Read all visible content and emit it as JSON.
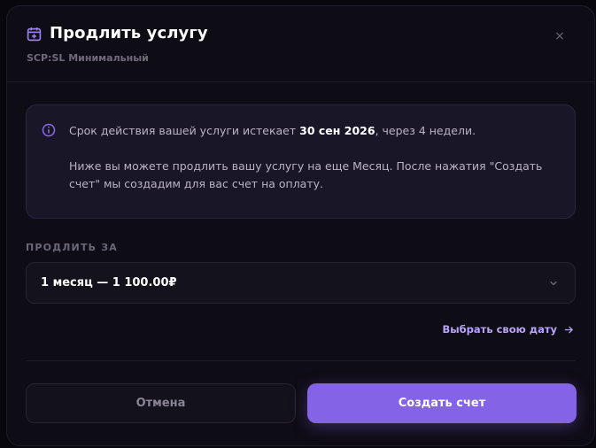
{
  "modal": {
    "title": "Продлить услугу",
    "subtitle": "SCP:SL Минимальный",
    "close_icon": "×"
  },
  "info": {
    "line1_before": "Срок действия вашей услуги истекает ",
    "line1_date": "30 сен 2026",
    "line1_after": ", через 4 недели.",
    "paragraph2": "Ниже вы можете продлить вашу услугу на еще Месяц. После нажатия \"Создать счет\" мы создадим для вас счет на оплату."
  },
  "extend": {
    "label": "ПРОДЛИТЬ ЗА",
    "selected": "1 месяц — 1 100.00₽"
  },
  "custom_date": {
    "label": "Выбрать свою дату"
  },
  "actions": {
    "cancel": "Отмена",
    "create": "Создать счет"
  },
  "colors": {
    "accent": "#8463e6",
    "link": "#b9a4f7",
    "modal_bg": "#0e0c15",
    "info_bg": "#191628"
  },
  "icons": {
    "title": "calendar-plus-icon",
    "close": "close-icon",
    "info": "info-icon",
    "select": "chevron-down-icon",
    "custom_date": "arrow-right-icon"
  }
}
